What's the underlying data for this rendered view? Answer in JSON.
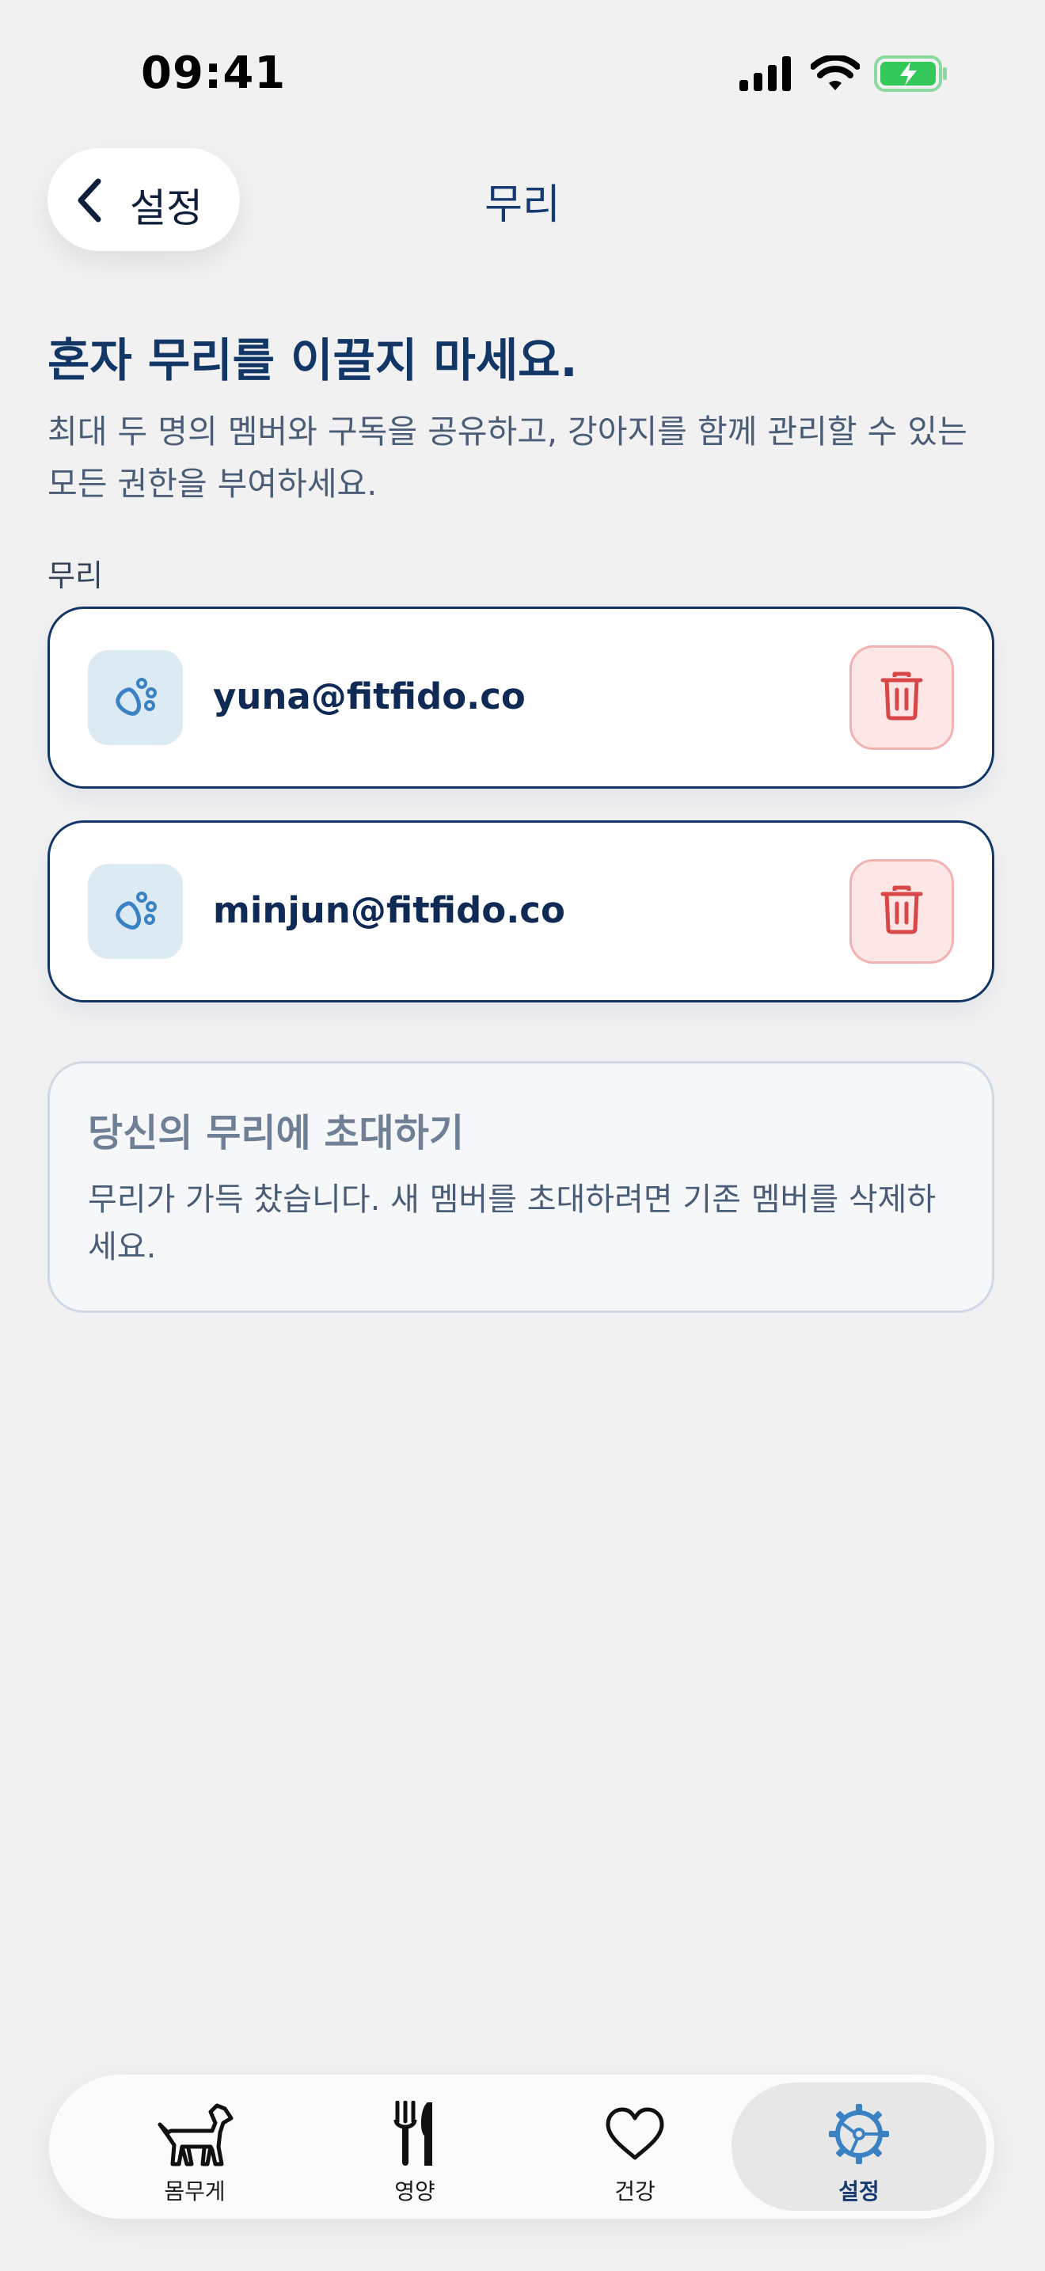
{
  "status_bar": {
    "time": "09:41",
    "icons": [
      "cellular-signal-icon",
      "wifi-icon",
      "battery-charging-icon"
    ],
    "battery_color": "#34c759"
  },
  "nav": {
    "back_label": "설정",
    "title": "무리"
  },
  "intro": {
    "headline": "혼자 무리를 이끌지 마세요.",
    "description": "최대 두 명의 멤버와 구독을 공유하고, 강아지를 함께 관리할 수 있는 모든 권한을 부여하세요."
  },
  "members": {
    "section_label": "무리",
    "items": [
      {
        "email": "yuna@fitfido.co",
        "icon": "paw-icon",
        "action_icon": "trash-icon"
      },
      {
        "email": "minjun@fitfido.co",
        "icon": "paw-icon",
        "action_icon": "trash-icon"
      }
    ]
  },
  "invite": {
    "title": "당신의 무리에 초대하기",
    "message": "무리가 가득 찼습니다. 새 멤버를 초대하려면 기존 멤버를 삭제하세요."
  },
  "tabs": [
    {
      "label": "몸무게",
      "icon": "dog-icon",
      "active": false
    },
    {
      "label": "영양",
      "icon": "fork-knife-icon",
      "active": false
    },
    {
      "label": "건강",
      "icon": "heart-icon",
      "active": false
    },
    {
      "label": "설정",
      "icon": "gear-icon",
      "active": true
    }
  ],
  "colors": {
    "primary": "#123766",
    "accent_blue": "#3b82c4",
    "danger": "#d94848",
    "danger_bg": "#fde6e6",
    "background": "#f1f1f2"
  }
}
